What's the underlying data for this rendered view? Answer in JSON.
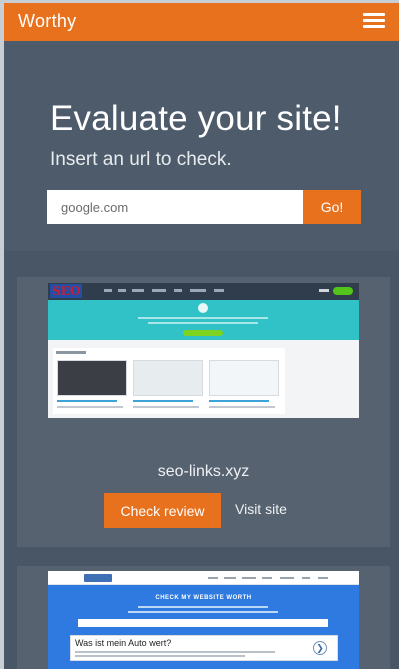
{
  "header": {
    "brand": "Worthy",
    "menu_icon": "hamburger-menu-icon"
  },
  "hero": {
    "title": "Evaluate your site!",
    "subtitle": "Insert an url to check.",
    "url_value": "google.com",
    "go_label": "Go!"
  },
  "cards": [
    {
      "thumbnail_logo": "SEO",
      "site_name": "seo-links.xyz",
      "check_label": "Check review",
      "visit_label": "Visit site"
    },
    {
      "thumbnail_heading": "CHECK MY WEBSITE WORTH",
      "thumbnail_ad_title": "Was ist mein Auto wert?",
      "thumbnail_ad_icon": "arrow-right-circle-icon"
    }
  ],
  "colors": {
    "accent": "#e8711e",
    "page_bg": "#485665",
    "hero_bg": "#4d5b6a",
    "card_bg": "#56626f"
  }
}
